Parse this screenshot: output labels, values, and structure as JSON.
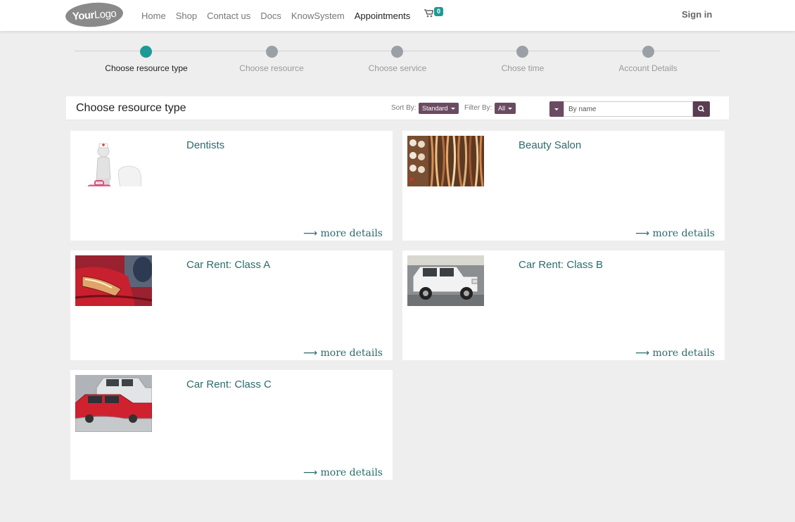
{
  "brand": {
    "logo_bold": "Your",
    "logo_thin": "Logo"
  },
  "nav": {
    "items": [
      {
        "label": "Home"
      },
      {
        "label": "Shop"
      },
      {
        "label": "Contact us"
      },
      {
        "label": "Docs"
      },
      {
        "label": "KnowSystem"
      },
      {
        "label": "Appointments"
      }
    ],
    "cart_count": "0",
    "signin": "Sign in"
  },
  "steps": [
    {
      "label": "Choose resource type",
      "active": true
    },
    {
      "label": "Choose resource",
      "active": false
    },
    {
      "label": "Choose service",
      "active": false
    },
    {
      "label": "Chose time",
      "active": false
    },
    {
      "label": "Account Details",
      "active": false
    }
  ],
  "toolbar": {
    "title": "Choose resource type",
    "sort_label": "Sort By:",
    "sort_value": "Standard",
    "filter_label": "Filter By:",
    "filter_value": "All",
    "search_placeholder": "By name"
  },
  "cards": [
    {
      "title": "Dentists",
      "more": "more details",
      "icon": "dentist-image"
    },
    {
      "title": "Beauty Salon",
      "more": "more details",
      "icon": "beauty-salon-image"
    },
    {
      "title": "Car Rent: Class A",
      "more": "more details",
      "icon": "red-car-image"
    },
    {
      "title": "Car Rent: Class B",
      "more": "more details",
      "icon": "white-jeep-image"
    },
    {
      "title": "Car Rent: Class C",
      "more": "more details",
      "icon": "parked-cars-image"
    }
  ],
  "colors": {
    "accent": "#1d9a95",
    "button": "#6b4b62",
    "link": "#2b6b6d"
  }
}
